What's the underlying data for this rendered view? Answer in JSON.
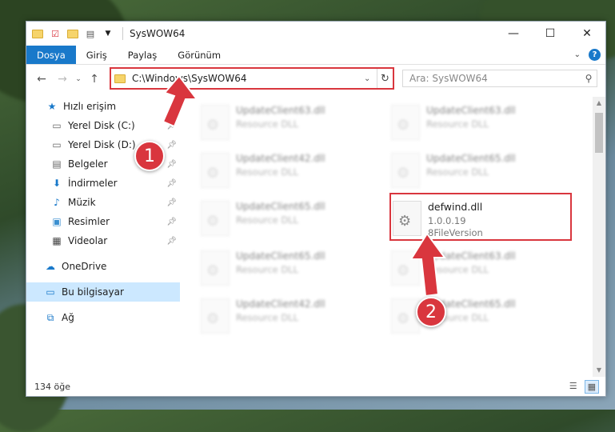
{
  "window": {
    "title": "SysWOW64"
  },
  "ribbon": {
    "tabs": [
      "Dosya",
      "Giriş",
      "Paylaş",
      "Görünüm"
    ],
    "help": "?"
  },
  "address": {
    "path": "C:\\Windows\\SysWOW64"
  },
  "search": {
    "placeholder": "Ara: SysWOW64"
  },
  "sidebar": {
    "items": [
      {
        "label": "Hızlı erişim",
        "icon": "star-icon",
        "pinned": false
      },
      {
        "label": "Yerel Disk (C:)",
        "icon": "drive-icon",
        "pinned": true
      },
      {
        "label": "Yerel Disk (D:)",
        "icon": "drive-icon",
        "pinned": true
      },
      {
        "label": "Belgeler",
        "icon": "document-icon",
        "pinned": true
      },
      {
        "label": "İndirmeler",
        "icon": "download-icon",
        "pinned": true
      },
      {
        "label": "Müzik",
        "icon": "music-icon",
        "pinned": true
      },
      {
        "label": "Resimler",
        "icon": "picture-icon",
        "pinned": true
      },
      {
        "label": "Videolar",
        "icon": "video-icon",
        "pinned": true
      }
    ],
    "onedrive": "OneDrive",
    "thispc": "Bu bilgisayar",
    "network": "Ağ"
  },
  "files": [
    {
      "name": "UpdateClient63.dll",
      "sub": "Resource DLL"
    },
    {
      "name": "UpdateClient63.dll",
      "sub": "Resource DLL"
    },
    {
      "name": "UpdateClient42.dll",
      "sub": "Resource DLL"
    },
    {
      "name": "UpdateClient65.dll",
      "sub": "Resource DLL"
    },
    {
      "name": "UpdateClient65.dll",
      "sub": "Resource DLL"
    },
    {
      "name": "defwind.dll",
      "version": "1.0.0.19",
      "sub": "8FileVersion"
    },
    {
      "name": "UpdateClient65.dll",
      "sub": "Resource DLL"
    },
    {
      "name": "UpdateClient63.dll",
      "sub": "Resource DLL"
    },
    {
      "name": "UpdateClient42.dll",
      "sub": "Resource DLL"
    },
    {
      "name": "UpdateClient65.dll",
      "sub": "Resource DLL"
    }
  ],
  "status": {
    "count": "134 öğe"
  },
  "annotations": {
    "step1": "1",
    "step2": "2"
  },
  "colors": {
    "accent": "#1979ca",
    "highlight": "#d9363e"
  }
}
